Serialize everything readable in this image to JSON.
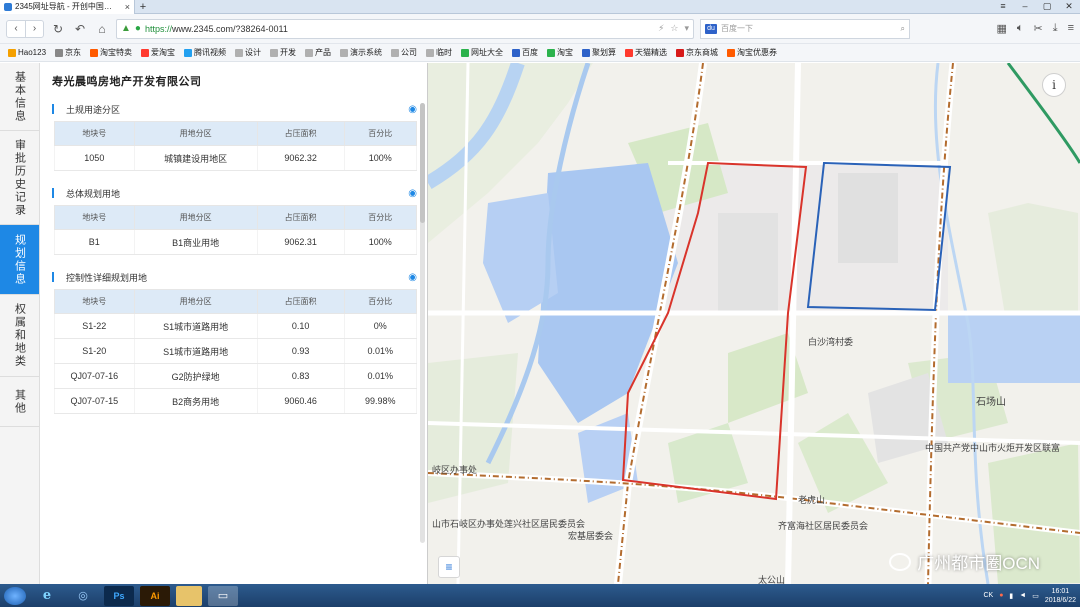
{
  "browser": {
    "tab_title": "2345网址导航 - 开创中国…",
    "tab_close": "×",
    "new_tab": "+",
    "url_https": "https://",
    "url_rest": "www.2345.com/?38264-0011",
    "search_placeholder": "百度一下",
    "bookmarks": [
      {
        "label": "Hao123",
        "color": "#f4a000"
      },
      {
        "label": "京东",
        "color": "#888888"
      },
      {
        "label": "淘宝特卖",
        "color": "#ff5a00"
      },
      {
        "label": "爱淘宝",
        "color": "#ff3a2f"
      },
      {
        "label": "腾讯视频",
        "color": "#22a0f0"
      },
      {
        "label": "设计",
        "color": "#b0b0b0"
      },
      {
        "label": "开发",
        "color": "#b0b0b0"
      },
      {
        "label": "产品",
        "color": "#b0b0b0"
      },
      {
        "label": "演示系统",
        "color": "#b0b0b0"
      },
      {
        "label": "公司",
        "color": "#b0b0b0"
      },
      {
        "label": "临时",
        "color": "#b0b0b0"
      },
      {
        "label": "网址大全",
        "color": "#2bb24c"
      },
      {
        "label": "百度",
        "color": "#2e62c9"
      },
      {
        "label": "淘宝",
        "color": "#2bb24c"
      },
      {
        "label": "聚划算",
        "color": "#2e62c9"
      },
      {
        "label": "天猫精选",
        "color": "#ff3a2f"
      },
      {
        "label": "京东商城",
        "color": "#d71a1a"
      },
      {
        "label": "淘宝优惠券",
        "color": "#ff5a00"
      }
    ]
  },
  "sidenav": [
    {
      "label": "基本信息",
      "active": false,
      "h": 68
    },
    {
      "label": "审批历史记录",
      "active": false,
      "h": 94
    },
    {
      "label": "规划信息",
      "active": true,
      "h": 70
    },
    {
      "label": "权属和地类",
      "active": false,
      "h": 82
    },
    {
      "label": "其他",
      "active": false,
      "h": 50
    }
  ],
  "panel": {
    "title": "寿光晨鸣房地产开发有限公司",
    "sections": [
      {
        "name": "土规用途分区",
        "headers": [
          "地块号",
          "用地分区",
          "占压面积",
          "百分比"
        ],
        "rows": [
          [
            "1050",
            "城镇建设用地区",
            "9062.32",
            "100%"
          ]
        ]
      },
      {
        "name": "总体规划用地",
        "headers": [
          "地块号",
          "用地分区",
          "占压面积",
          "百分比"
        ],
        "rows": [
          [
            "B1",
            "B1商业用地",
            "9062.31",
            "100%"
          ]
        ]
      },
      {
        "name": "控制性详细规划用地",
        "headers": [
          "地块号",
          "用地分区",
          "占压面积",
          "百分比"
        ],
        "rows": [
          [
            "S1-22",
            "S1城市道路用地",
            "0.10",
            "0%"
          ],
          [
            "S1-20",
            "S1城市道路用地",
            "0.93",
            "0.01%"
          ],
          [
            "QJ07-07-16",
            "G2防护绿地",
            "0.83",
            "0.01%"
          ],
          [
            "QJ07-07-15",
            "B2商务用地",
            "9060.46",
            "99.98%"
          ]
        ]
      }
    ]
  },
  "map": {
    "labels": {
      "village": "白沙湾村委",
      "shichangshan": "石场山",
      "party_committee": "中国共产党中山市火炬开发区联富",
      "district_office": "岐区办事处",
      "shiqi_office": "山市石岐区办事处莲兴社区居民委员会",
      "laohushan": "老虎山",
      "qifuhai": "齐富海社区居民委员会",
      "hongji": "宏基居委会",
      "taigongshan": "太公山",
      "watermark": "广州都市圈OCN"
    },
    "info_glyph": "i",
    "list_glyph": "≡"
  },
  "taskbar": {
    "time": "16:01",
    "date": "2018/6/22",
    "lang": "CK"
  }
}
